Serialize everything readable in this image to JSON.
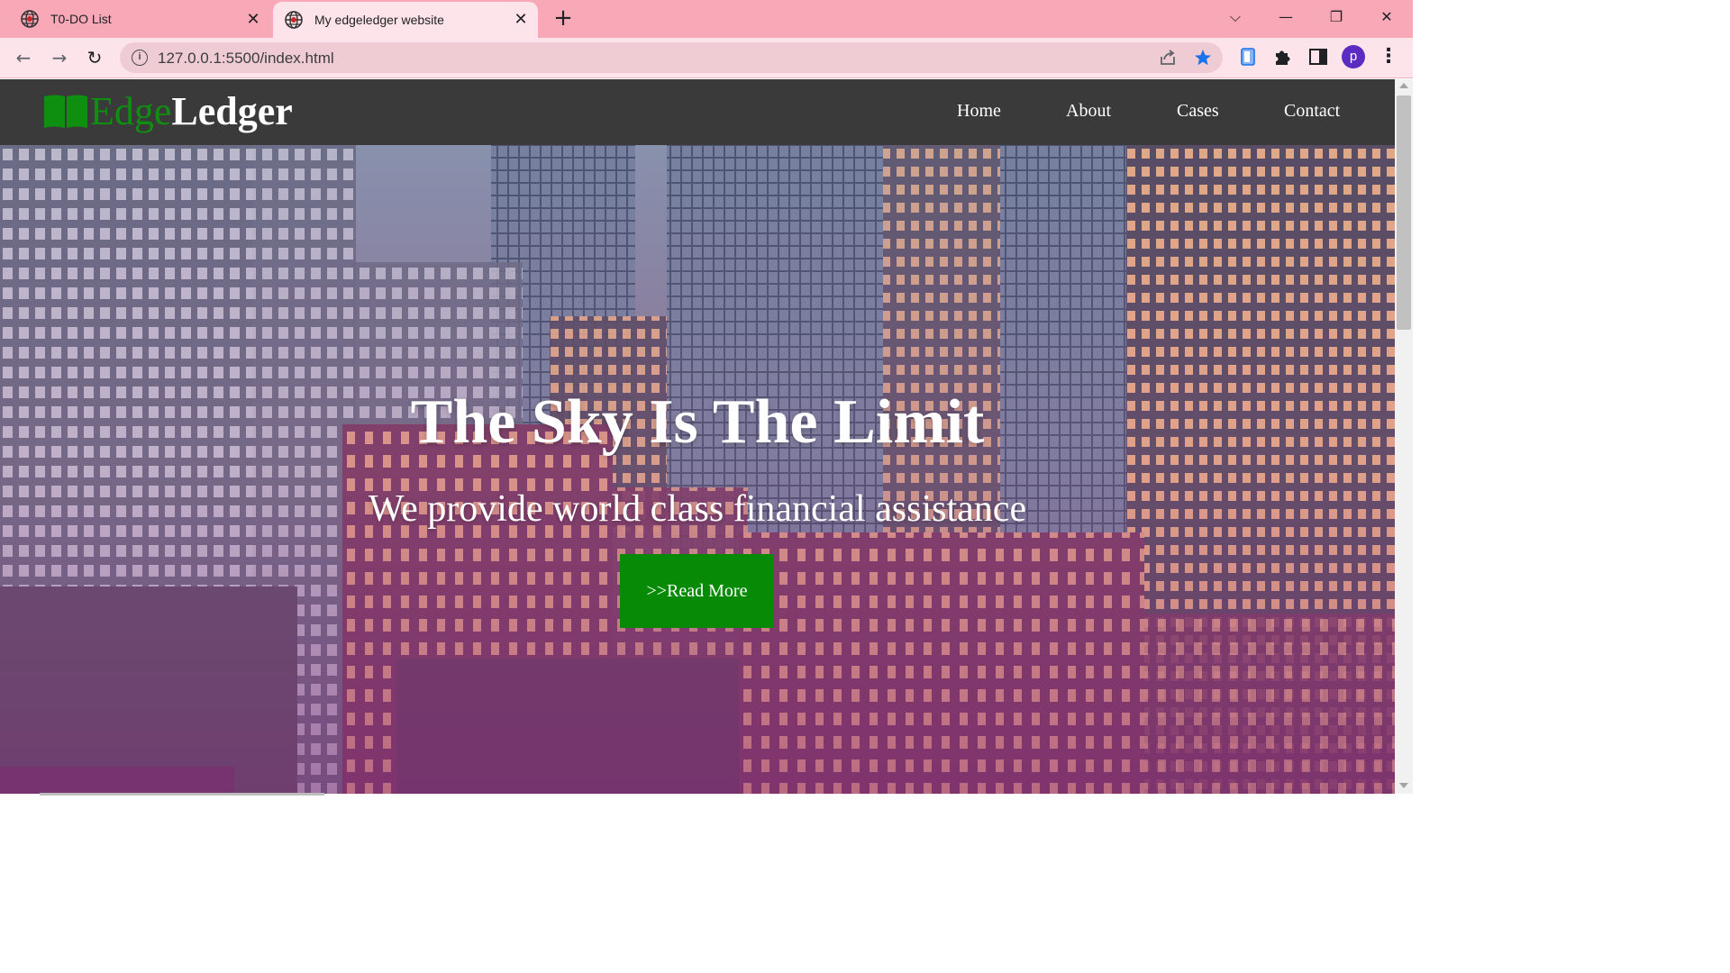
{
  "browser": {
    "tabs": [
      {
        "title": "T0-DO List",
        "active": false
      },
      {
        "title": "My edgeledger website",
        "active": true
      }
    ],
    "new_tab_icon": "plus-icon",
    "window_controls": {
      "dropdown": "⌵",
      "minimize": "—",
      "restore": "❐",
      "close": "✕"
    },
    "url": "127.0.0.1:5500/index.html",
    "profile_initial": "p",
    "accent_color": "#f9a8b8",
    "bookmark_star_color": "#1a73e8"
  },
  "site": {
    "logo": {
      "part1": "Edge",
      "part2": "Ledger",
      "icon": "book-icon",
      "part1_color": "#0f8f0f"
    },
    "nav": {
      "home": "Home",
      "about": "About",
      "cases": "Cases",
      "contact": "Contact"
    },
    "hero": {
      "title": "The Sky Is The Limit",
      "subtitle": "We provide world class financial assistance",
      "button": ">>Read More",
      "button_color": "#078b07"
    }
  }
}
